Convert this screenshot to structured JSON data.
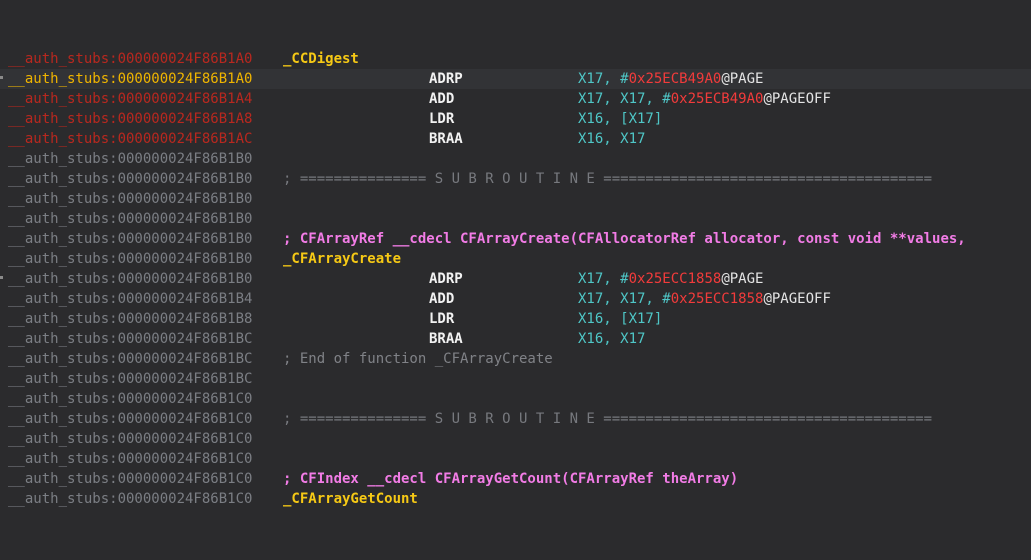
{
  "lines": [
    {
      "addr": "__auth_stubs:000000024F86B1A0",
      "addr_style": "red",
      "body": "_CCDigest",
      "body_style": "label"
    },
    {
      "addr": "__auth_stubs:000000024F86B1A0",
      "addr_style": "hl",
      "marker": true,
      "selected": true,
      "mnem": "ADRP",
      "ops": [
        {
          "t": "X17, ",
          "s": "reg"
        },
        {
          "t": "#",
          "s": "reg"
        },
        {
          "t": "0x25ECB49A0",
          "s": "imm"
        },
        {
          "t": "@PAGE",
          "s": "sym"
        }
      ]
    },
    {
      "addr": "__auth_stubs:000000024F86B1A4",
      "addr_style": "red",
      "mnem": "ADD",
      "ops": [
        {
          "t": "X17, X17, ",
          "s": "reg"
        },
        {
          "t": "#",
          "s": "reg"
        },
        {
          "t": "0x25ECB49A0",
          "s": "imm"
        },
        {
          "t": "@PAGEOFF",
          "s": "sym"
        }
      ]
    },
    {
      "addr": "__auth_stubs:000000024F86B1A8",
      "addr_style": "red",
      "mnem": "LDR",
      "ops": [
        {
          "t": "X16, [X17]",
          "s": "reg"
        }
      ]
    },
    {
      "addr": "__auth_stubs:000000024F86B1AC",
      "addr_style": "red",
      "mnem": "BRAA",
      "ops": [
        {
          "t": "X16, X17",
          "s": "reg"
        }
      ]
    },
    {
      "addr": "__auth_stubs:000000024F86B1B0",
      "addr_style": "gray"
    },
    {
      "addr": "__auth_stubs:000000024F86B1B0",
      "addr_style": "gray",
      "body": "; =============== S U B R O U T I N E =======================================",
      "body_style": "comment-sep"
    },
    {
      "addr": "__auth_stubs:000000024F86B1B0",
      "addr_style": "gray"
    },
    {
      "addr": "__auth_stubs:000000024F86B1B0",
      "addr_style": "gray"
    },
    {
      "addr": "__auth_stubs:000000024F86B1B0",
      "addr_style": "gray",
      "body": "; CFArrayRef __cdecl CFArrayCreate(CFAllocatorRef allocator, const void **values,",
      "body_style": "decl"
    },
    {
      "addr": "__auth_stubs:000000024F86B1B0",
      "addr_style": "gray",
      "body": "_CFArrayCreate",
      "body_style": "label"
    },
    {
      "addr": "__auth_stubs:000000024F86B1B0",
      "addr_style": "gray",
      "marker": true,
      "mnem": "ADRP",
      "ops": [
        {
          "t": "X17, ",
          "s": "reg"
        },
        {
          "t": "#",
          "s": "reg"
        },
        {
          "t": "0x25ECC1858",
          "s": "imm"
        },
        {
          "t": "@PAGE",
          "s": "sym"
        }
      ]
    },
    {
      "addr": "__auth_stubs:000000024F86B1B4",
      "addr_style": "gray",
      "mnem": "ADD",
      "ops": [
        {
          "t": "X17, X17, ",
          "s": "reg"
        },
        {
          "t": "#",
          "s": "reg"
        },
        {
          "t": "0x25ECC1858",
          "s": "imm"
        },
        {
          "t": "@PAGEOFF",
          "s": "sym"
        }
      ]
    },
    {
      "addr": "__auth_stubs:000000024F86B1B8",
      "addr_style": "gray",
      "mnem": "LDR",
      "ops": [
        {
          "t": "X16, [X17]",
          "s": "reg"
        }
      ]
    },
    {
      "addr": "__auth_stubs:000000024F86B1BC",
      "addr_style": "gray",
      "mnem": "BRAA",
      "ops": [
        {
          "t": "X16, X17",
          "s": "reg"
        }
      ]
    },
    {
      "addr": "__auth_stubs:000000024F86B1BC",
      "addr_style": "gray",
      "body": "; End of function _CFArrayCreate",
      "body_style": "comment-dim"
    },
    {
      "addr": "__auth_stubs:000000024F86B1BC",
      "addr_style": "gray"
    },
    {
      "addr": "__auth_stubs:000000024F86B1C0",
      "addr_style": "gray"
    },
    {
      "addr": "__auth_stubs:000000024F86B1C0",
      "addr_style": "gray",
      "body": "; =============== S U B R O U T I N E =======================================",
      "body_style": "comment-sep"
    },
    {
      "addr": "__auth_stubs:000000024F86B1C0",
      "addr_style": "gray"
    },
    {
      "addr": "__auth_stubs:000000024F86B1C0",
      "addr_style": "gray"
    },
    {
      "addr": "__auth_stubs:000000024F86B1C0",
      "addr_style": "gray",
      "body": "; CFIndex __cdecl CFArrayGetCount(CFArrayRef theArray)",
      "body_style": "decl"
    },
    {
      "addr": "__auth_stubs:000000024F86B1C0",
      "addr_style": "gray",
      "body": "_CFArrayGetCount",
      "body_style": "label"
    }
  ]
}
